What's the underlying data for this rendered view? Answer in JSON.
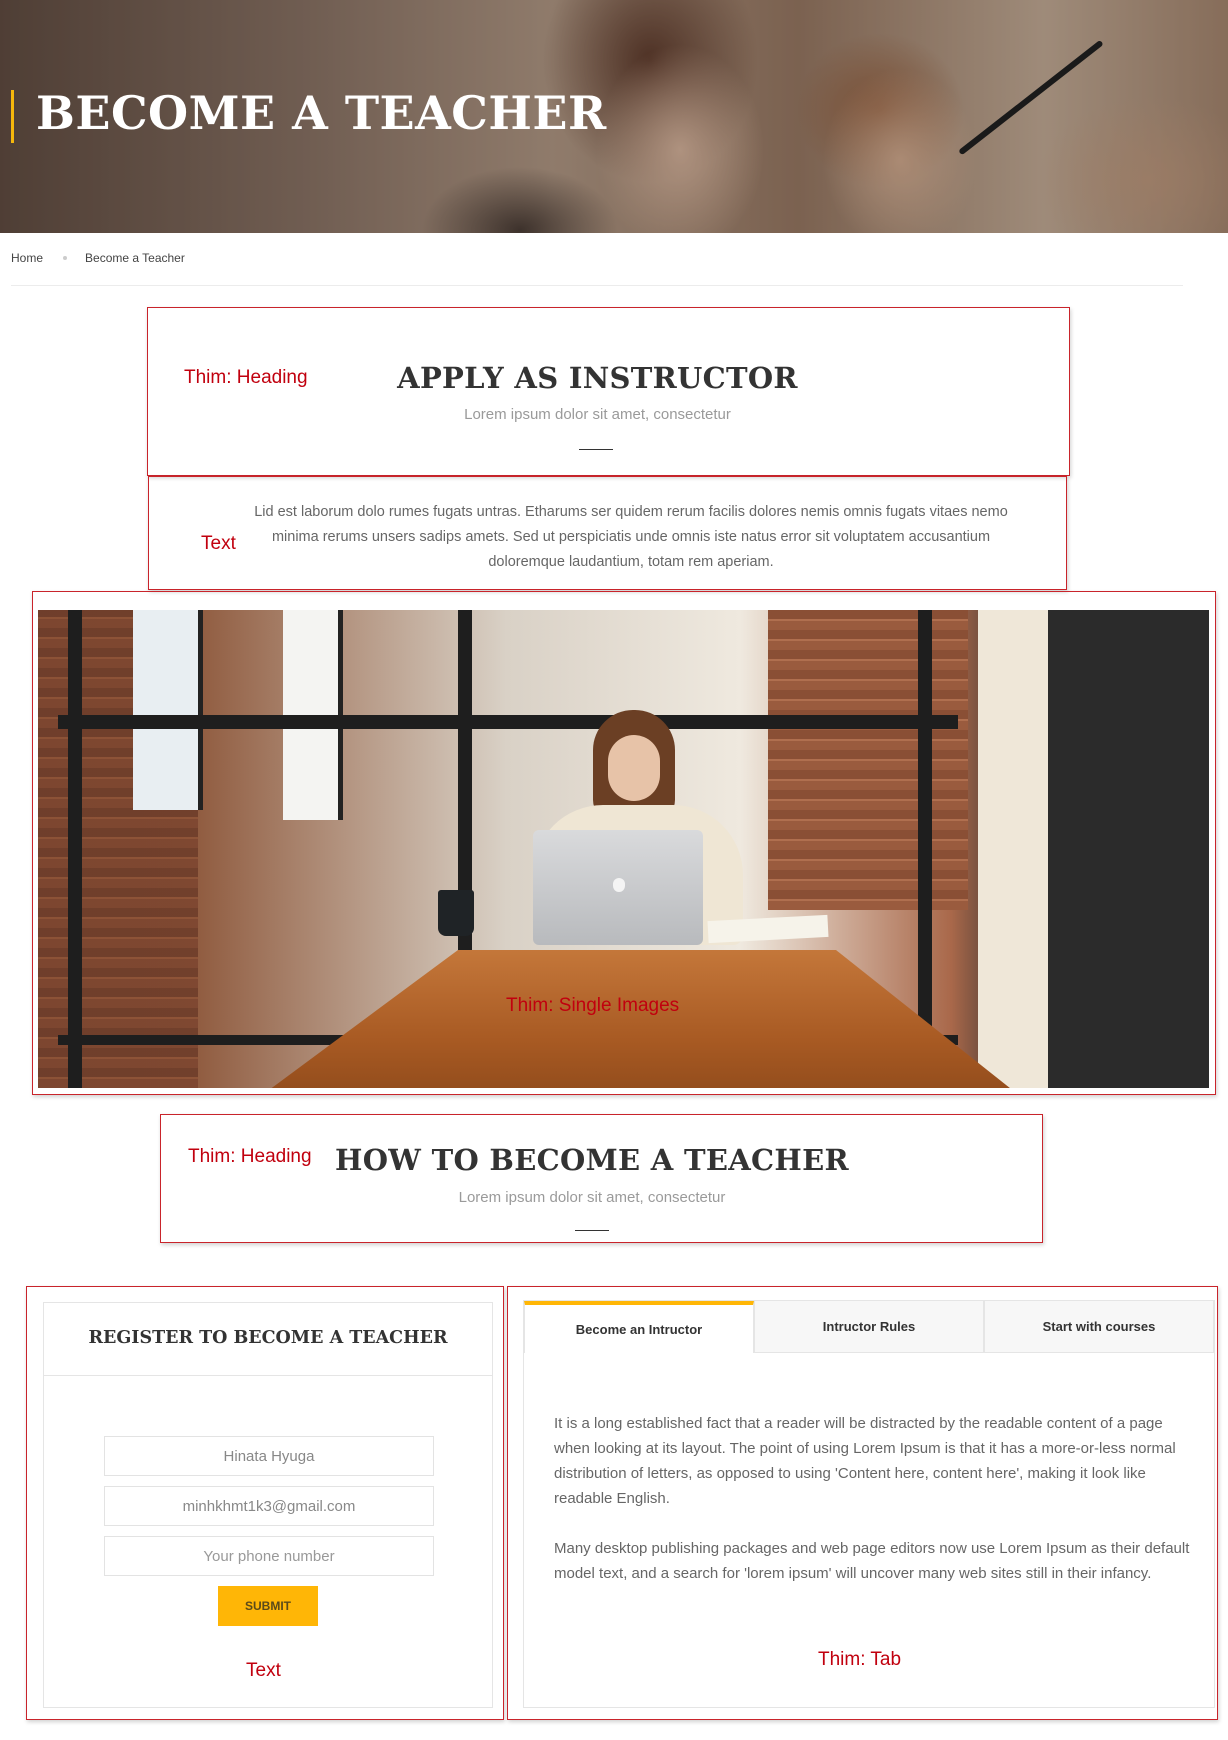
{
  "hero": {
    "title": "BECOME A TEACHER"
  },
  "breadcrumb": {
    "home": "Home",
    "current": "Become a Teacher"
  },
  "annotations": {
    "heading_1": "Thim: Heading",
    "text_1": "Text",
    "single_images": "Thim: Single Images",
    "heading_2": "Thim: Heading",
    "text_2": "Text",
    "tab": "Thim: Tab"
  },
  "apply_section": {
    "title": "APPLY AS INSTRUCTOR",
    "subtitle": "Lorem ipsum dolor sit amet, consectetur",
    "body": "Lid est laborum dolo rumes fugats untras. Etharums ser quidem rerum facilis dolores nemis omnis fugats vitaes nemo minima rerums unsers sadips amets. Sed ut perspiciatis unde omnis iste natus error sit voluptatem accusantium doloremque laudantium, totam rem aperiam."
  },
  "how_section": {
    "title": "HOW TO BECOME A TEACHER",
    "subtitle": "Lorem ipsum dolor sit amet, consectetur"
  },
  "register_form": {
    "title": "REGISTER TO BECOME A TEACHER",
    "name_value": "Hinata Hyuga",
    "email_value": "minhkhmt1k3@gmail.com",
    "phone_placeholder": "Your phone number",
    "submit_label": "SUBMIT"
  },
  "tabs": {
    "items": [
      {
        "label": "Become an Intructor",
        "active": true
      },
      {
        "label": "Intructor Rules",
        "active": false
      },
      {
        "label": "Start with courses",
        "active": false
      }
    ],
    "content": {
      "paragraph_1": "It is a long established fact that a reader will be distracted by the readable content of a page when looking at its layout. The point of using Lorem Ipsum is that it has a more-or-less normal distribution of letters, as opposed to using 'Content here, content here', making it look like readable English.",
      "paragraph_2": "Many desktop publishing packages and web page editors now use Lorem Ipsum as their default model text, and a search for 'lorem ipsum' will uncover many web sites still in their infancy."
    }
  },
  "colors": {
    "accent": "#ffb606",
    "annotation": "#c9242b"
  }
}
